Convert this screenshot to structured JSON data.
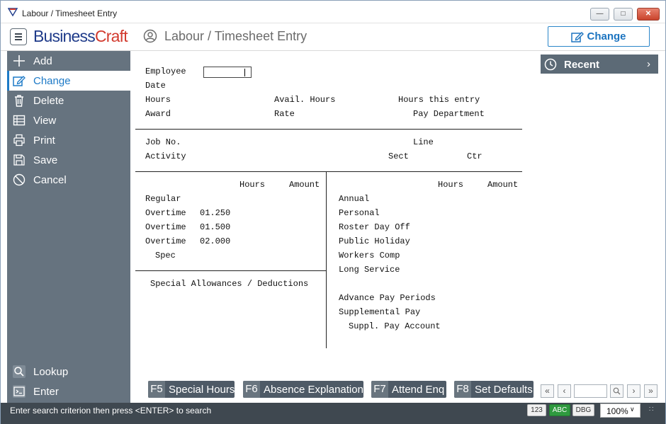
{
  "window": {
    "title": "Labour / Timesheet Entry"
  },
  "header": {
    "logo_business": "Business",
    "logo_craft": "Craft",
    "title": "Labour / Timesheet Entry",
    "mode_button": "Change"
  },
  "sidebar": {
    "items": [
      {
        "label": "Add",
        "icon": "plus-icon"
      },
      {
        "label": "Change",
        "icon": "edit-icon"
      },
      {
        "label": "Delete",
        "icon": "trash-icon"
      },
      {
        "label": "View",
        "icon": "table-icon"
      },
      {
        "label": "Print",
        "icon": "printer-icon"
      },
      {
        "label": "Save",
        "icon": "save-icon"
      },
      {
        "label": "Cancel",
        "icon": "cancel-icon"
      }
    ],
    "bottom_items": [
      {
        "label": "Lookup",
        "icon": "search-icon"
      },
      {
        "label": "Enter",
        "icon": "enter-icon"
      }
    ]
  },
  "form": {
    "employee": "Employee",
    "employee_value": "",
    "date": "Date",
    "hours": "Hours",
    "avail_hours": "Avail. Hours",
    "hours_this_entry": "Hours this entry",
    "award": "Award",
    "rate": "Rate",
    "pay_department": "Pay Department",
    "job_no": "Job No.",
    "line": "Line",
    "activity": "Activity",
    "sect": "Sect",
    "ctr": "Ctr",
    "left_hours_header": "Hours",
    "left_amount_header": "Amount",
    "regular": "Regular",
    "overtime_rows": [
      {
        "label": "Overtime",
        "rate": "01.250"
      },
      {
        "label": "Overtime",
        "rate": "01.500"
      },
      {
        "label": "Overtime",
        "rate": "02.000"
      }
    ],
    "spec": "Spec",
    "special_allowances": "Special Allowances / Deductions",
    "right_hours_header": "Hours",
    "right_amount_header": "Amount",
    "leave_types": [
      "Annual",
      "Personal",
      "Roster Day Off",
      "Public Holiday",
      "Workers Comp",
      "Long Service"
    ],
    "advance_pay_periods": "Advance Pay Periods",
    "supplemental_pay": "Supplemental Pay",
    "suppl_pay_account": "Suppl. Pay Account"
  },
  "recent": {
    "label": "Recent"
  },
  "function_keys": [
    {
      "key": "F5",
      "label": "Special Hours"
    },
    {
      "key": "F6",
      "label": "Absence Explanation"
    },
    {
      "key": "F7",
      "label": "Attend Enq"
    },
    {
      "key": "F8",
      "label": "Set Defaults"
    }
  ],
  "pager": {
    "value": ""
  },
  "status": {
    "message": "Enter search criterion then press <ENTER> to search",
    "num_badge": "123",
    "abc_badge": "ABC",
    "dbg_badge": "DBG",
    "zoom": "100%"
  },
  "colors": {
    "sidebar": "#66737f",
    "accent": "#1d7ac7",
    "statusbar": "#3f4850",
    "logo_blue": "#1f3b8a",
    "logo_red": "#d23a2e"
  }
}
